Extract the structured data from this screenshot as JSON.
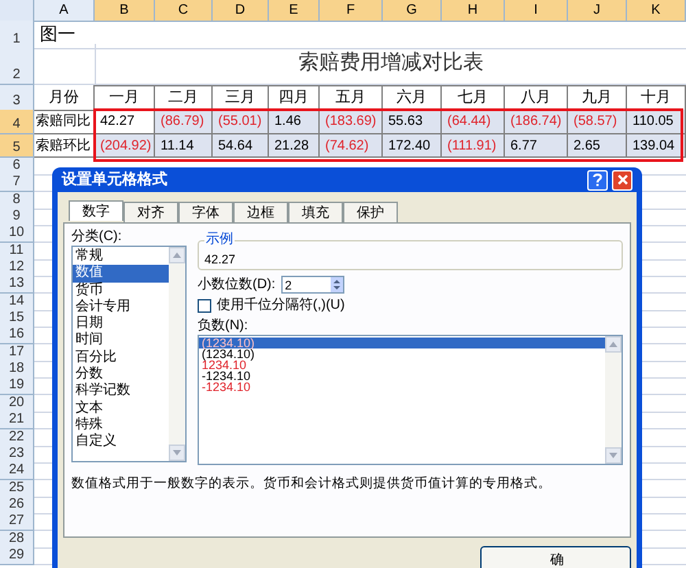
{
  "column_headers": [
    {
      "label": "A",
      "selected": false
    },
    {
      "label": "B",
      "selected": true
    },
    {
      "label": "C",
      "selected": true
    },
    {
      "label": "D",
      "selected": true
    },
    {
      "label": "E",
      "selected": true
    },
    {
      "label": "F",
      "selected": true
    },
    {
      "label": "G",
      "selected": true
    },
    {
      "label": "H",
      "selected": true
    },
    {
      "label": "I",
      "selected": true
    },
    {
      "label": "J",
      "selected": true
    },
    {
      "label": "K",
      "selected": true
    }
  ],
  "row_numbers": [
    {
      "label": "1",
      "selected": false
    },
    {
      "label": "2",
      "selected": false
    },
    {
      "label": "3",
      "selected": false
    },
    {
      "label": "4",
      "selected": true
    },
    {
      "label": "5",
      "selected": true
    },
    {
      "label": "6",
      "selected": false
    },
    {
      "label": "7",
      "selected": false
    },
    {
      "label": "8",
      "selected": false
    },
    {
      "label": "9",
      "selected": false
    },
    {
      "label": "10",
      "selected": false
    },
    {
      "label": "11",
      "selected": false
    },
    {
      "label": "12",
      "selected": false
    },
    {
      "label": "13",
      "selected": false
    },
    {
      "label": "14",
      "selected": false
    },
    {
      "label": "15",
      "selected": false
    },
    {
      "label": "16",
      "selected": false
    },
    {
      "label": "17",
      "selected": false
    },
    {
      "label": "18",
      "selected": false
    },
    {
      "label": "19",
      "selected": false
    },
    {
      "label": "20",
      "selected": false
    },
    {
      "label": "21",
      "selected": false
    },
    {
      "label": "22",
      "selected": false
    },
    {
      "label": "23",
      "selected": false
    },
    {
      "label": "24",
      "selected": false
    },
    {
      "label": "25",
      "selected": false
    },
    {
      "label": "26",
      "selected": false
    },
    {
      "label": "27",
      "selected": false
    },
    {
      "label": "28",
      "selected": false
    },
    {
      "label": "29",
      "selected": false
    }
  ],
  "caption": "图一",
  "title": "索赔费用增减对比表",
  "months_label": "月份",
  "months": [
    "一月",
    "二月",
    "三月",
    "四月",
    "五月",
    "六月",
    "七月",
    "八月",
    "九月",
    "十月"
  ],
  "data_rows": [
    {
      "label": "索赔同比",
      "cells": [
        {
          "text": "42.27",
          "negative": false,
          "active": true
        },
        {
          "text": "(86.79)",
          "negative": true,
          "active": false
        },
        {
          "text": "(55.01)",
          "negative": true,
          "active": false
        },
        {
          "text": "1.46",
          "negative": false,
          "active": false
        },
        {
          "text": "(183.69)",
          "negative": true,
          "active": false
        },
        {
          "text": "55.63",
          "negative": false,
          "active": false
        },
        {
          "text": "(64.44)",
          "negative": true,
          "active": false
        },
        {
          "text": "(186.74)",
          "negative": true,
          "active": false
        },
        {
          "text": "(58.57)",
          "negative": true,
          "active": false
        },
        {
          "text": "110.05",
          "negative": false,
          "active": false
        }
      ]
    },
    {
      "label": "索赔环比",
      "cells": [
        {
          "text": "(204.92)",
          "negative": true,
          "active": false
        },
        {
          "text": "11.14",
          "negative": false,
          "active": false
        },
        {
          "text": "54.64",
          "negative": false,
          "active": false
        },
        {
          "text": "21.28",
          "negative": false,
          "active": false
        },
        {
          "text": "(74.62)",
          "negative": true,
          "active": false
        },
        {
          "text": "172.40",
          "negative": false,
          "active": false
        },
        {
          "text": "(111.91)",
          "negative": true,
          "active": false
        },
        {
          "text": "6.77",
          "negative": false,
          "active": false
        },
        {
          "text": "2.65",
          "negative": false,
          "active": false
        },
        {
          "text": "139.04",
          "negative": false,
          "active": false
        }
      ]
    }
  ],
  "dialog": {
    "title": "设置单元格格式",
    "tabs": [
      {
        "label": "数字",
        "selected": true
      },
      {
        "label": "对齐",
        "selected": false
      },
      {
        "label": "字体",
        "selected": false
      },
      {
        "label": "边框",
        "selected": false
      },
      {
        "label": "填充",
        "selected": false
      },
      {
        "label": "保护",
        "selected": false
      }
    ],
    "category_label": "分类(C):",
    "categories": [
      {
        "label": "常规",
        "selected": false
      },
      {
        "label": "数值",
        "selected": true
      },
      {
        "label": "货币",
        "selected": false
      },
      {
        "label": "会计专用",
        "selected": false
      },
      {
        "label": "日期",
        "selected": false
      },
      {
        "label": "时间",
        "selected": false
      },
      {
        "label": "百分比",
        "selected": false
      },
      {
        "label": "分数",
        "selected": false
      },
      {
        "label": "科学记数",
        "selected": false
      },
      {
        "label": "文本",
        "selected": false
      },
      {
        "label": "特殊",
        "selected": false
      },
      {
        "label": "自定义",
        "selected": false
      }
    ],
    "sample_label": "示例",
    "sample_value": "42.27",
    "decimal_label": "小数位数(D):",
    "decimal_value": "2",
    "thousands": {
      "label": "使用千位分隔符(,)(U)",
      "checked": false
    },
    "negative_label": "负数(N):",
    "negative_formats": [
      {
        "label": "(1234.10)",
        "red": true,
        "selected": true
      },
      {
        "label": "(1234.10)",
        "red": false,
        "selected": false
      },
      {
        "label": "1234.10",
        "red": true,
        "selected": false
      },
      {
        "label": "-1234.10",
        "red": false,
        "selected": false
      },
      {
        "label": "-1234.10",
        "red": true,
        "selected": false
      }
    ],
    "description": "数值格式用于一般数字的表示。货币和会计格式则提供货币值计算的专用格式。",
    "ok_button": "确"
  }
}
